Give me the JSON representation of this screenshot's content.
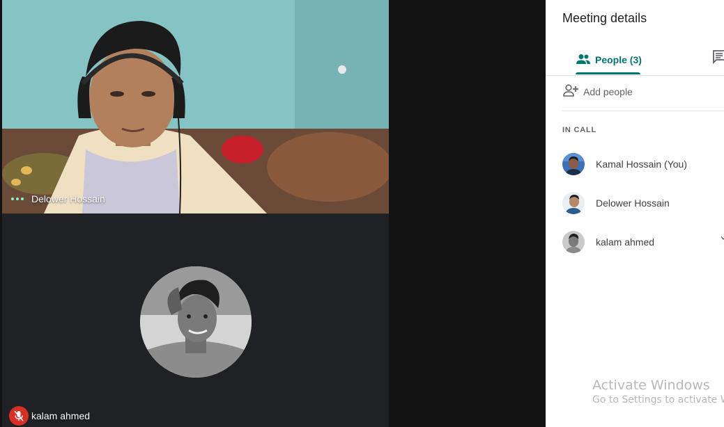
{
  "stage": {
    "tiles": [
      {
        "name": "Delower Hossain",
        "kind": "video",
        "speaking": true
      },
      {
        "name": "kalam ahmed",
        "kind": "avatar",
        "muted": true
      }
    ]
  },
  "panel": {
    "title": "Meeting details",
    "tabs": [
      {
        "label": "People (3)",
        "icon": "people-icon",
        "active": true
      },
      {
        "label": "",
        "icon": "chat-icon",
        "active": false
      }
    ],
    "add_people_label": "Add people",
    "section_label": "IN CALL",
    "participants": [
      {
        "name": "Kamal Hossain (You)"
      },
      {
        "name": "Delower Hossain"
      },
      {
        "name": "kalam ahmed"
      }
    ]
  },
  "watermark": {
    "line1": "Activate Windows",
    "line2": "Go to Settings to activate Wi"
  },
  "colors": {
    "accent": "#00796b",
    "mic_muted": "#d93025",
    "speaking_dots": "#8ff0d0",
    "stage_bg": "#121212",
    "tile_bg": "#202124"
  }
}
